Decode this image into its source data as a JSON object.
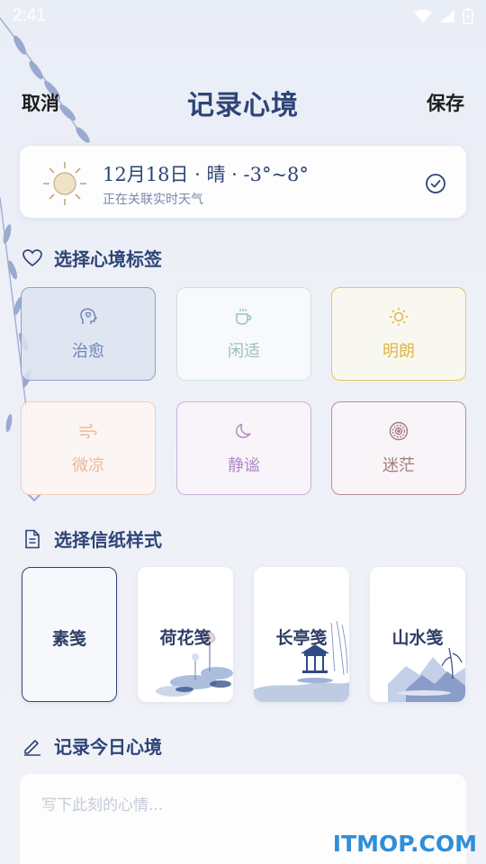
{
  "status_bar": {
    "time": "2:41"
  },
  "header": {
    "cancel_label": "取消",
    "title": "记录心境",
    "save_label": "保存"
  },
  "weather": {
    "date_line": "12月18日 · 晴 · -3°~8°",
    "status_text": "正在关联实时天气"
  },
  "mood_section": {
    "title": "选择心境标签",
    "tags": [
      {
        "label": "治愈",
        "icon": "head-heart-icon",
        "color": "#6f86b4",
        "selected": true
      },
      {
        "label": "闲适",
        "icon": "tea-cup-icon",
        "color": "#9cc4b4",
        "selected": false
      },
      {
        "label": "明朗",
        "icon": "sun-icon",
        "color": "#e0b64a",
        "selected": false
      },
      {
        "label": "微凉",
        "icon": "wind-icon",
        "color": "#f2b597",
        "selected": false
      },
      {
        "label": "静谧",
        "icon": "moon-icon",
        "color": "#b08ac4",
        "selected": false
      },
      {
        "label": "迷茫",
        "icon": "spiral-icon",
        "color": "#a57c7c",
        "selected": false
      }
    ]
  },
  "paper_section": {
    "title": "选择信纸样式",
    "papers": [
      {
        "label": "素笺",
        "selected": true
      },
      {
        "label": "荷花笺",
        "selected": false
      },
      {
        "label": "长亭笺",
        "selected": false
      },
      {
        "label": "山水笺",
        "selected": false
      }
    ]
  },
  "entry_section": {
    "title": "记录今日心境",
    "placeholder": "写下此刻的心情..."
  },
  "watermark": "ITMOP.COM",
  "colors": {
    "accent": "#2d4476",
    "background": "#eceff7"
  }
}
